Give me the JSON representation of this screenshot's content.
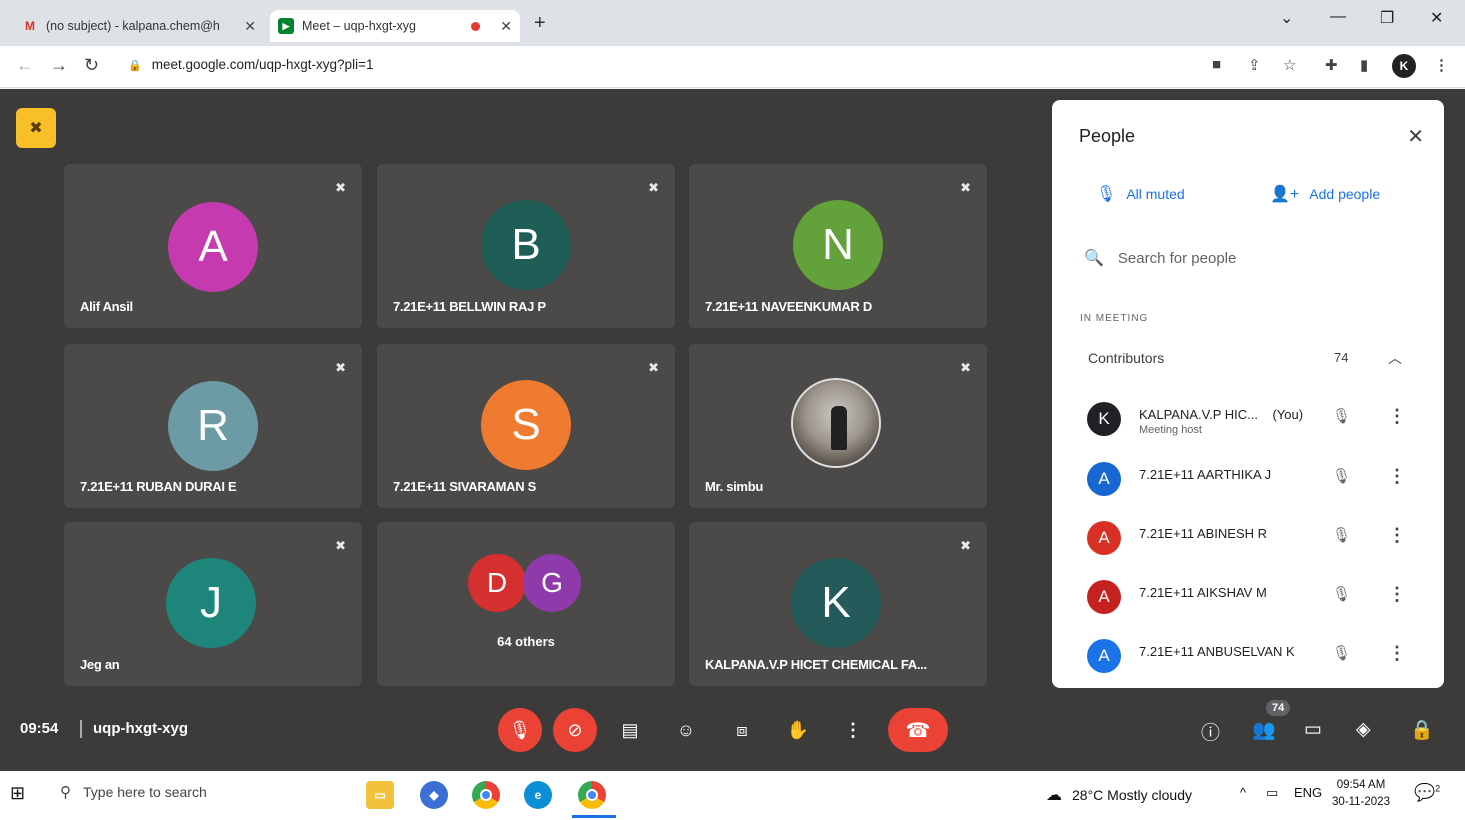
{
  "browser": {
    "tabs": [
      {
        "label": "(no subject) - kalpana.chem@h",
        "favicon": "gmail-icon"
      },
      {
        "label": "Meet – uqp-hxgt-xyg",
        "favicon": "meet-icon"
      }
    ],
    "url": "meet.google.com/uqp-hxgt-xyg?pli=1",
    "profile_initial": "K"
  },
  "tiles": [
    {
      "initial": "A",
      "name": "Alif Ansil",
      "color": "#c53aaf"
    },
    {
      "initial": "B",
      "name": "7.21E+11 BELLWIN RAJ P",
      "color": "#1f5d57"
    },
    {
      "initial": "N",
      "name": "7.21E+11 NAVEENKUMAR D",
      "color": "#63a13a"
    },
    {
      "initial": "R",
      "name": "7.21E+11 RUBAN DURAI E",
      "color": "#6d9ba5"
    },
    {
      "initial": "S",
      "name": "7.21E+11 SIVARAMAN S",
      "color": "#ee7b2f"
    },
    {
      "initial": "",
      "name": "Mr. simbu",
      "color": ""
    },
    {
      "initial": "J",
      "name": "Jeg an",
      "color": "#1e857b"
    },
    {
      "initial": "",
      "name": "64 others",
      "color": ""
    },
    {
      "initial": "K",
      "name": "KALPANA.V.P HICET CHEMICAL FA...",
      "color": "#255a5a"
    }
  ],
  "others_avatars": [
    {
      "initial": "D",
      "color": "#d62f2f"
    },
    {
      "initial": "G",
      "color": "#8e3aab"
    }
  ],
  "bottom_bar": {
    "time": "09:54",
    "meeting_code": "uqp-hxgt-xyg",
    "participant_count": "74"
  },
  "people_panel": {
    "title": "People",
    "all_muted": "All muted",
    "add_people": "Add people",
    "search_placeholder": "Search for people",
    "section": "IN MEETING",
    "group_label": "Contributors",
    "group_count": "74",
    "participants": [
      {
        "initial": "K",
        "name": "KALPANA.V.P HIC...",
        "you": "(You)",
        "sub": "Meeting host",
        "color": "#202124"
      },
      {
        "initial": "A",
        "name": "7.21E+11 AARTHIKA J",
        "you": "",
        "sub": "",
        "color": "#1967d2"
      },
      {
        "initial": "A",
        "name": "7.21E+11 ABINESH R",
        "you": "",
        "sub": "",
        "color": "#d93025"
      },
      {
        "initial": "A",
        "name": "7.21E+11 AIKSHAV M",
        "you": "",
        "sub": "",
        "color": "#c5221f"
      },
      {
        "initial": "A",
        "name": "7.21E+11 ANBUSELVAN K",
        "you": "",
        "sub": "",
        "color": "#1a73e8"
      }
    ]
  },
  "taskbar": {
    "search_placeholder": "Type here to search",
    "weather": "28°C  Mostly cloudy",
    "lang": "ENG",
    "time": "09:54 AM",
    "date": "30-11-2023",
    "notif_count": "2"
  }
}
